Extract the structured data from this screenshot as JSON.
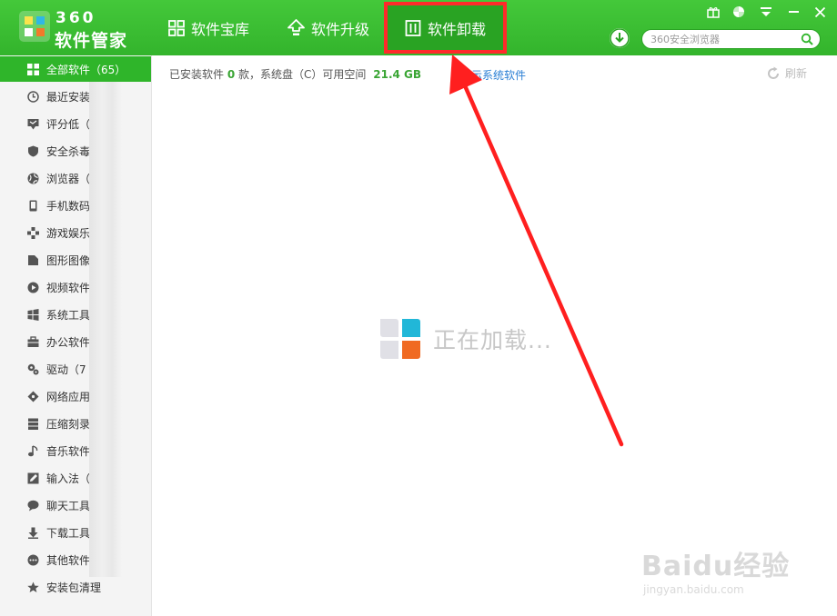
{
  "app": {
    "logo_number": "360",
    "logo_name": "软件管家"
  },
  "tabs": [
    {
      "label": "软件宝库",
      "icon": "grid-icon"
    },
    {
      "label": "软件升级",
      "icon": "upgrade-arrow-icon"
    },
    {
      "label": "软件卸载",
      "icon": "trash-icon",
      "active": true
    }
  ],
  "search": {
    "placeholder": "360安全浏览器"
  },
  "sidebar": {
    "items": [
      {
        "label": "全部软件（65）",
        "icon": "grid-icon",
        "active": true
      },
      {
        "label": "最近安装",
        "icon": "clock-icon"
      },
      {
        "label": "评分低（",
        "icon": "thumbs-down-icon"
      },
      {
        "label": "安全杀毒",
        "icon": "shield-icon"
      },
      {
        "label": "浏览器（",
        "icon": "globe-icon"
      },
      {
        "label": "手机数码",
        "icon": "phone-icon"
      },
      {
        "label": "游戏娱乐",
        "icon": "gamepad-icon"
      },
      {
        "label": "图形图像",
        "icon": "image-icon"
      },
      {
        "label": "视频软件",
        "icon": "play-icon"
      },
      {
        "label": "系统工具",
        "icon": "windows-icon"
      },
      {
        "label": "办公软件",
        "icon": "briefcase-icon"
      },
      {
        "label": "驱动（7",
        "icon": "gears-icon"
      },
      {
        "label": "网络应用",
        "icon": "network-icon"
      },
      {
        "label": "压缩刻录",
        "icon": "archive-icon"
      },
      {
        "label": "音乐软件",
        "icon": "music-note-icon"
      },
      {
        "label": "输入法（",
        "icon": "pencil-icon"
      },
      {
        "label": "聊天工具",
        "icon": "chat-bubble-icon"
      },
      {
        "label": "下载工具",
        "icon": "download-arrow-icon"
      },
      {
        "label": "其他软件",
        "icon": "more-dots-icon"
      },
      {
        "label": "安装包清理",
        "icon": "star-icon"
      }
    ]
  },
  "info": {
    "prefix": "已安装软件",
    "installed_count": "0",
    "middle": "款，系统盘（C）可用空间",
    "free_space": "21.4 GB"
  },
  "show_system_link": "显示系统软件",
  "refresh_label": "刷新",
  "loading_text": "正在加载...",
  "watermark": {
    "main": "Baidu经验",
    "sub": "jingyan.baidu.com"
  },
  "colors": {
    "header_green": "#3dbf34",
    "active_green": "#2fb52a",
    "highlight_red": "#ff2a2a",
    "link_blue": "#2a7fd4"
  }
}
